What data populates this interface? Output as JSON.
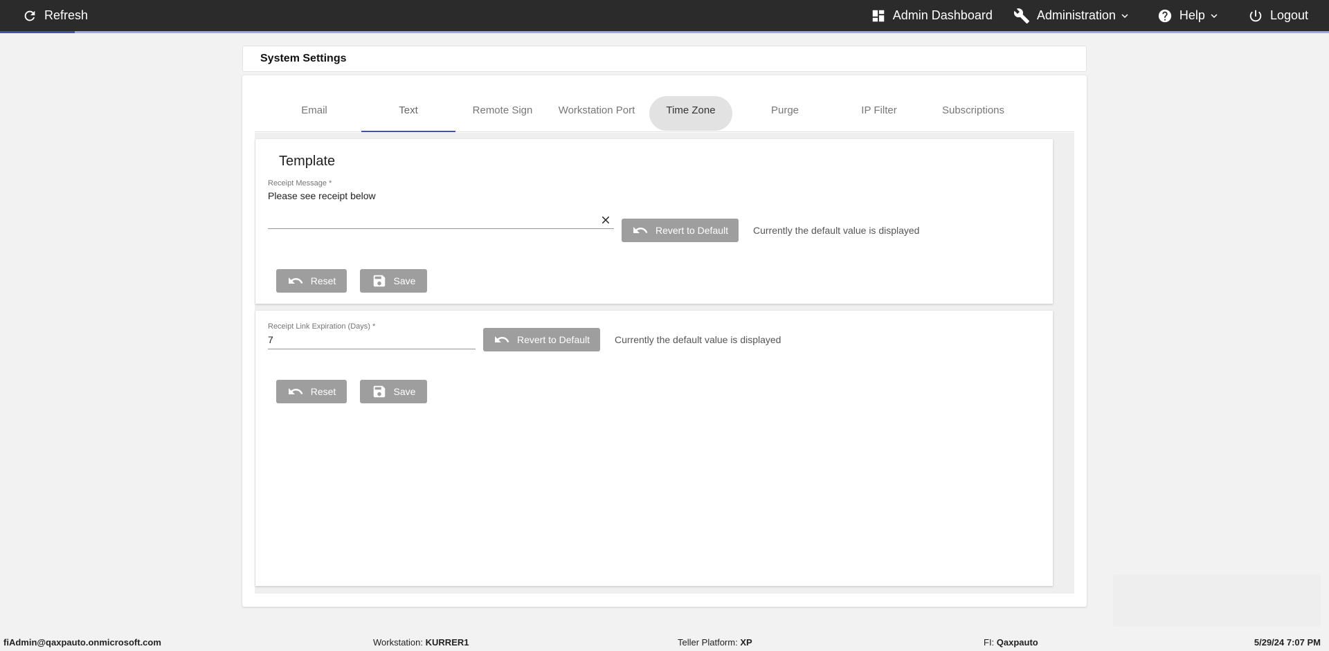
{
  "topbar": {
    "refresh_label": "Refresh",
    "dashboard_label": "Admin Dashboard",
    "administration_label": "Administration",
    "help_label": "Help",
    "logout_label": "Logout"
  },
  "loading_progress_percent": 5.6,
  "page": {
    "title": "System Settings"
  },
  "tabs": [
    {
      "label": "Email"
    },
    {
      "label": "Text"
    },
    {
      "label": "Remote Sign"
    },
    {
      "label": "Workstation Port"
    },
    {
      "label": "Time Zone"
    },
    {
      "label": "Purge"
    },
    {
      "label": "IP Filter"
    },
    {
      "label": "Subscriptions"
    }
  ],
  "active_tab": "Text",
  "template_panel": {
    "heading": "Template",
    "receipt_message_label": "Receipt Message *",
    "receipt_message_value": "Please see receipt below",
    "revert_label": "Revert to Default",
    "default_hint": "Currently the default value is displayed",
    "reset_label": "Reset",
    "save_label": "Save"
  },
  "expiration_panel": {
    "expiration_label": "Receipt Link Expiration (Days) *",
    "expiration_value": "7",
    "revert_label": "Revert to Default",
    "default_hint": "Currently the default value is displayed",
    "reset_label": "Reset",
    "save_label": "Save"
  },
  "footer": {
    "user": "fiAdmin@qaxpauto.onmicrosoft.com",
    "workstation_label": "Workstation:",
    "workstation_value": "KURRER1",
    "platform_label": "Teller Platform:",
    "platform_value": "XP",
    "fi_label": "FI:",
    "fi_value": "Qaxpauto",
    "datetime": "5/29/24 7:07 PM"
  },
  "colors": {
    "topbar": "#2b2b2b",
    "accent": "#3f51b5",
    "disabled_button": "#9e9e9e"
  }
}
